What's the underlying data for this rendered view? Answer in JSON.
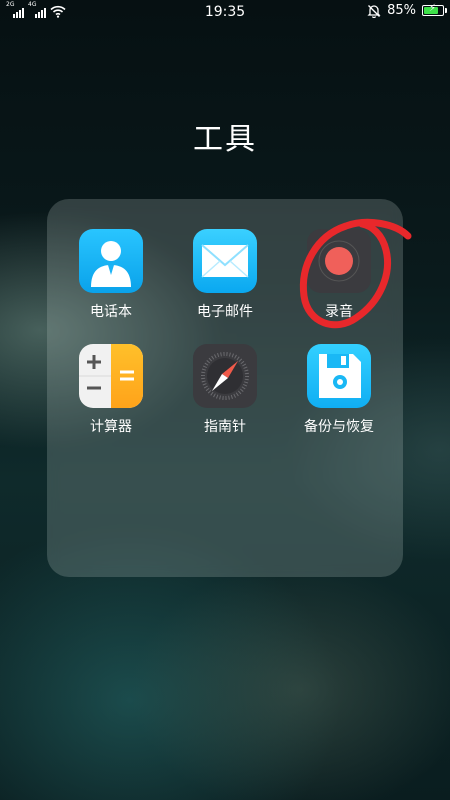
{
  "status_bar": {
    "sim1_label": "2G",
    "sim2_label": "4G",
    "time": "19:35",
    "battery_percent": "85%",
    "battery_level": 0.85,
    "battery_color": "#3ee04a"
  },
  "folder": {
    "title": "工具",
    "apps": [
      {
        "label": "电话本",
        "icon": "contacts-icon"
      },
      {
        "label": "电子邮件",
        "icon": "email-icon"
      },
      {
        "label": "录音",
        "icon": "recorder-icon"
      },
      {
        "label": "计算器",
        "icon": "calculator-icon"
      },
      {
        "label": "指南针",
        "icon": "compass-icon"
      },
      {
        "label": "备份与恢复",
        "icon": "backup-icon"
      }
    ]
  },
  "annotation_color": "#e8282b"
}
